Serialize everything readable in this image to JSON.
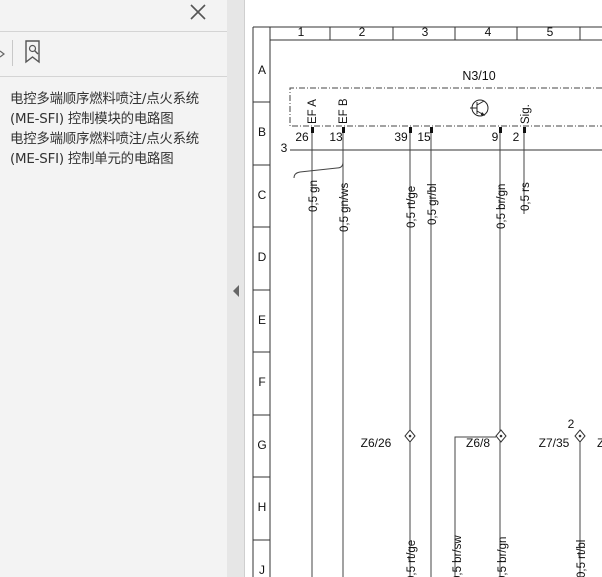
{
  "sidebar": {
    "outline": [
      {
        "label": "电控多端顺序燃料喷注/点火系统 (ME-SFI) 控制模块的电路图"
      },
      {
        "label": "电控多端顺序燃料喷注/点火系统 (ME-SFI) 控制单元的电路图"
      }
    ]
  },
  "icons": {
    "close": "close-icon",
    "bookmark": "bookmark-icon",
    "collapse": "collapse-arrow-icon"
  },
  "diagram": {
    "columns": [
      "1",
      "2",
      "3",
      "4",
      "5"
    ],
    "rows": [
      "A",
      "B",
      "C",
      "D",
      "E",
      "F",
      "G",
      "H",
      "J"
    ],
    "component": "N3/10",
    "ref_left": "3",
    "pin_labels": [
      "EF A",
      "EF B",
      "Sig."
    ],
    "pins": [
      "26",
      "13",
      "39",
      "15",
      "9",
      "2"
    ],
    "wires_top": [
      "0,5 gn",
      "0,5 gn/ws",
      "0,5 rt/ge",
      "0,5 gr/bl",
      "0,5 br/gn",
      "0,5 rs"
    ],
    "connectors": [
      "Z6/26",
      "Z6/8",
      "Z7/35",
      "Z"
    ],
    "connector_ref": "2",
    "wires_bottom": [
      "0,5 rt/ge",
      "0,5 br/sw",
      "0,5 br/gn",
      "0,5 rt/bl"
    ]
  },
  "colors": {
    "sidebar_bg": "#f3f3f3",
    "grid_line": "#333333",
    "text": "#111111"
  }
}
